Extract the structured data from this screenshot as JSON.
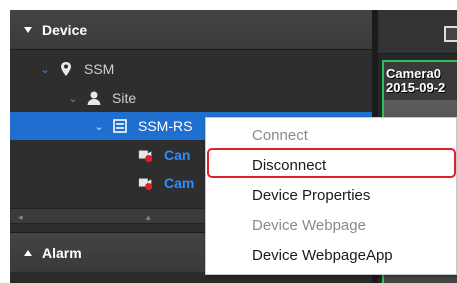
{
  "panels": {
    "device_header": "Device",
    "alarm_header": "Alarm"
  },
  "tree": {
    "ssm": "SSM",
    "site": "Site",
    "rs": "SSM-RS",
    "cam1": "Can",
    "cam2": "Cam"
  },
  "camera": {
    "name": "Camera0",
    "date": "2015-09-2"
  },
  "context_menu": {
    "items": [
      {
        "label": "Connect",
        "enabled": false
      },
      {
        "label": "Disconnect",
        "enabled": true
      },
      {
        "label": "Device Properties",
        "enabled": true
      },
      {
        "label": "Device Webpage",
        "enabled": false
      },
      {
        "label": "Device WebpageApp",
        "enabled": true
      }
    ],
    "highlighted": "Disconnect"
  },
  "colors": {
    "selection": "#1f6fd1",
    "highlight_border": "#e0202a",
    "camera_border": "#2fbf5a",
    "camera_text": "#2f8cff"
  }
}
